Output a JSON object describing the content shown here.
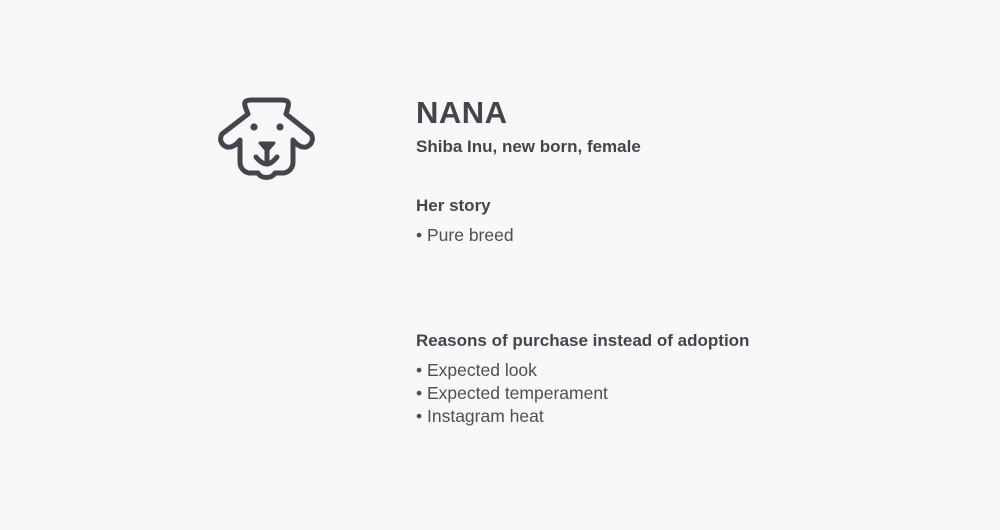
{
  "profile": {
    "icon": "dog-face-icon",
    "name": "NANA",
    "subtitle": "Shiba Inu, new born, female"
  },
  "story": {
    "title": "Her story",
    "items": [
      "• Pure breed"
    ]
  },
  "reasons": {
    "title": "Reasons of purchase instead of adoption",
    "items": [
      "• Expected look",
      "• Expected temperament",
      "• Instagram heat"
    ]
  },
  "colors": {
    "background": "#f8f8f9",
    "text": "#45434d",
    "icon": "#45434d"
  }
}
